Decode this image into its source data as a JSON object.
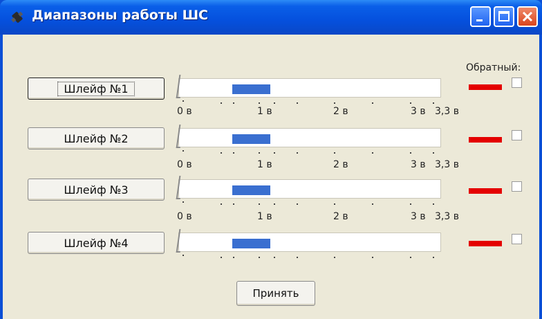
{
  "window": {
    "title": "Диапазоны работы ШС",
    "icon": "satellite-app-icon",
    "caption_buttons": [
      "minimize",
      "maximize",
      "close"
    ]
  },
  "reverse_header": "Обратный:",
  "scale": {
    "min": 0,
    "max": 3.3,
    "labels": [
      "0 в",
      "1 в",
      "2 в",
      "3 в",
      "3,3 в"
    ]
  },
  "range_color": "#3a6fd0",
  "indicator_color": "#e40000",
  "loops": [
    {
      "label": "Шлейф №1",
      "range_start_v": 0.65,
      "range_end_v": 1.15,
      "reverse": false,
      "focused": true
    },
    {
      "label": "Шлейф №2",
      "range_start_v": 0.65,
      "range_end_v": 1.15,
      "reverse": false,
      "focused": false
    },
    {
      "label": "Шлейф №3",
      "range_start_v": 0.65,
      "range_end_v": 1.15,
      "reverse": false,
      "focused": false
    },
    {
      "label": "Шлейф №4",
      "range_start_v": 0.65,
      "range_end_v": 1.15,
      "reverse": false,
      "focused": false
    }
  ],
  "accept_button": "Принять"
}
